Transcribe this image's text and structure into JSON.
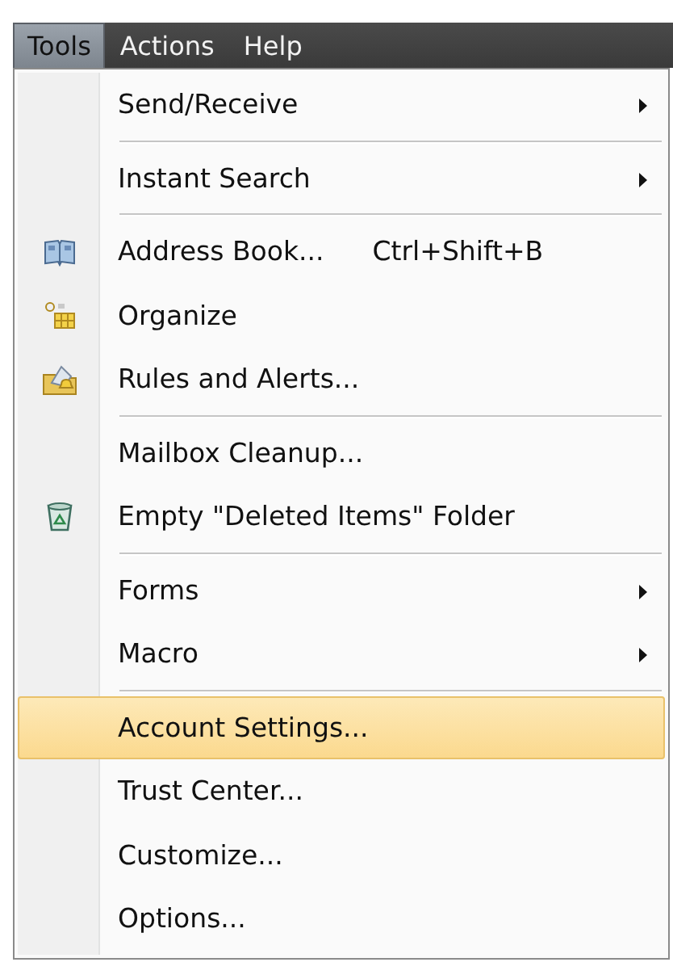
{
  "menubar": [
    {
      "label": "Tools",
      "selected": true
    },
    {
      "label": "Actions",
      "selected": false
    },
    {
      "label": "Help",
      "selected": false
    }
  ],
  "menu": {
    "items": [
      {
        "label": "Send/Receive",
        "submenu": true,
        "separator_after": true,
        "selected": false
      },
      {
        "label": "Instant Search",
        "submenu": true,
        "separator_after": true,
        "selected": false
      },
      {
        "label": "Address Book...",
        "shortcut": "Ctrl+Shift+B",
        "kind": "book",
        "selected": false
      },
      {
        "label": "Organize",
        "kind": "organize",
        "selected": false
      },
      {
        "label": "Rules and Alerts...",
        "kind": "rules",
        "separator_after": true,
        "selected": false
      },
      {
        "label": "Mailbox Cleanup...",
        "selected": false
      },
      {
        "label": "Empty \"Deleted Items\" Folder",
        "kind": "bin",
        "separator_after": true,
        "selected": false
      },
      {
        "label": "Forms",
        "submenu": true,
        "selected": false
      },
      {
        "label": "Macro",
        "submenu": true,
        "separator_after": true,
        "selected": false
      },
      {
        "label": "Account Settings...",
        "selected": true
      },
      {
        "label": "Trust Center...",
        "selected": false
      },
      {
        "label": "Customize...",
        "selected": false
      },
      {
        "label": "Options...",
        "selected": false
      }
    ]
  }
}
